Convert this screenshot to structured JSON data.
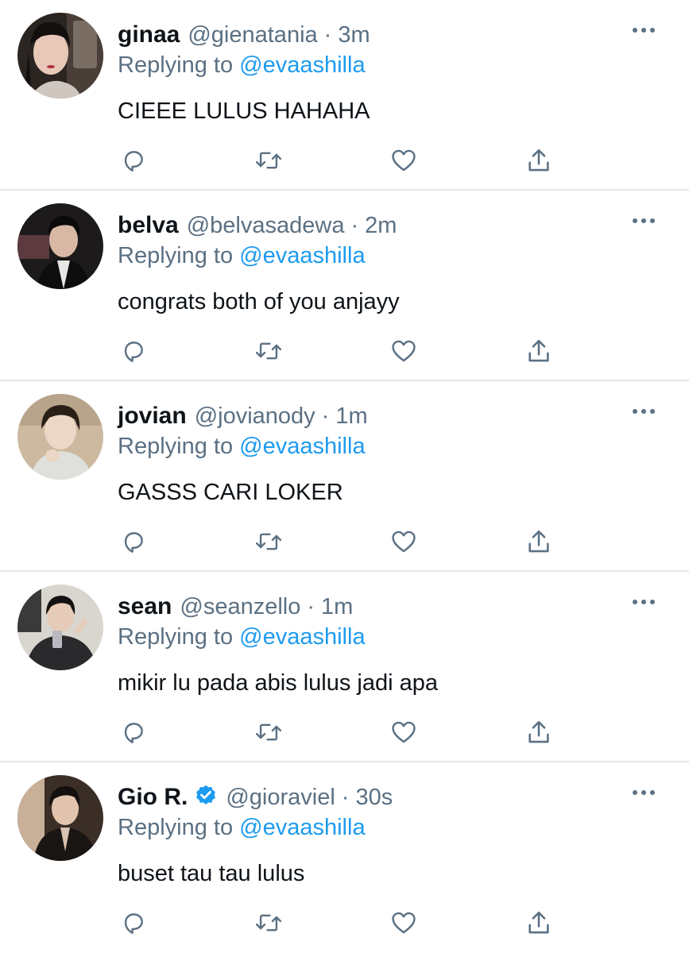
{
  "colors": {
    "text": "#0f1419",
    "secondary": "#5b7083",
    "accent": "#1d9bf0",
    "divider": "#e4e7ea",
    "verified": "#1d9bf0"
  },
  "icons": {
    "reply": "reply-icon",
    "retweet": "retweet-icon",
    "like": "heart-icon",
    "share": "share-icon",
    "more": "more-options-icon",
    "verified": "verified-badge-icon"
  },
  "replying_prefix": "Replying to",
  "tweets": [
    {
      "name": "ginaa",
      "handle": "@gienatania",
      "separator": "·",
      "time": "3m",
      "replying_to": "@evaashilla",
      "text": "CIEEE LULUS HAHAHA",
      "verified": false
    },
    {
      "name": "belva",
      "handle": "@belvasadewa",
      "separator": "·",
      "time": "2m",
      "replying_to": "@evaashilla",
      "text": "congrats both of you anjayy",
      "verified": false
    },
    {
      "name": "jovian",
      "handle": "@jovianody",
      "separator": "·",
      "time": "1m",
      "replying_to": "@evaashilla",
      "text": "GASSS CARI LOKER",
      "verified": false
    },
    {
      "name": "sean",
      "handle": "@seanzello",
      "separator": "·",
      "time": "1m",
      "replying_to": "@evaashilla",
      "text": "mikir lu pada abis lulus jadi apa",
      "verified": false
    },
    {
      "name": "Gio R.",
      "handle": "@gioraviel",
      "separator": "·",
      "time": "30s",
      "replying_to": "@evaashilla",
      "text": "buset tau tau lulus",
      "verified": true
    }
  ]
}
